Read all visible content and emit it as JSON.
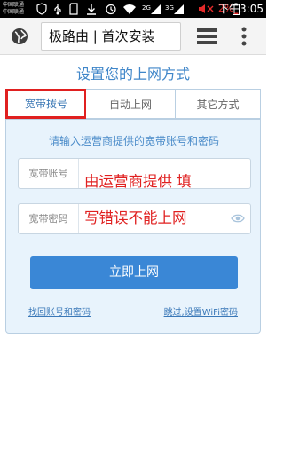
{
  "status_bar": {
    "carrier_1": "中国联通",
    "carrier_2": "中国联通",
    "battery_percent": "2%",
    "time": "下午3:05"
  },
  "browser": {
    "address_text": "极路由 | 首次安装",
    "icons": [
      "globe-icon",
      "tabs-icon",
      "overflow-menu-icon"
    ]
  },
  "page": {
    "title": "设置您的上网方式",
    "tabs": [
      {
        "label": "宽带拨号",
        "selected": true
      },
      {
        "label": "自动上网",
        "selected": false
      },
      {
        "label": "其它方式",
        "selected": false
      }
    ],
    "hint": "请输入运营商提供的宽带账号和密码",
    "fields": {
      "account_label": "宽带账号",
      "account_value": "",
      "password_label": "宽带密码",
      "password_value": ""
    },
    "submit_label": "立即上网",
    "link_left": "找回账号和密码",
    "link_right": "跳过,设置WiFi密码"
  },
  "annotation": {
    "line_1": "由运营商提供 填",
    "line_2": "写错误不能上网"
  },
  "colors": {
    "accent": "#3a87d6",
    "title": "#3f86c9",
    "panel_bg": "#e8f3fc",
    "annotation_red": "#e02020"
  }
}
